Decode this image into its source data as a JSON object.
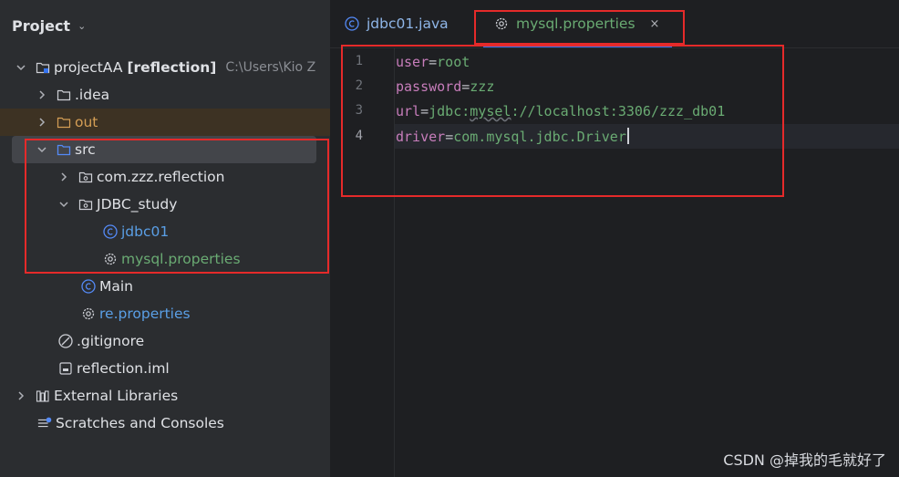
{
  "panel": {
    "title": "Project"
  },
  "tree": [
    {
      "label": "projectAA",
      "suffix": "[reflection]",
      "path": "C:\\Users\\Kio Z",
      "icon": "module-folder-icon",
      "arrow": "expanded"
    },
    {
      "label": ".idea",
      "icon": "folder-icon",
      "arrow": "collapsed"
    },
    {
      "label": "out",
      "icon": "folder-excluded-icon",
      "arrow": "collapsed"
    },
    {
      "label": "src",
      "icon": "source-folder-icon",
      "arrow": "expanded"
    },
    {
      "label": "com.zzz.reflection",
      "icon": "package-icon",
      "arrow": "collapsed"
    },
    {
      "label": "JDBC_study",
      "icon": "package-icon",
      "arrow": "expanded"
    },
    {
      "label": "jdbc01",
      "icon": "class-icon"
    },
    {
      "label": "mysql.properties",
      "icon": "properties-gear-icon"
    },
    {
      "label": "Main",
      "icon": "class-icon"
    },
    {
      "label": "re.properties",
      "icon": "properties-gear-icon"
    },
    {
      "label": ".gitignore",
      "icon": "ignored-file-icon"
    },
    {
      "label": "reflection.iml",
      "icon": "iml-file-icon"
    },
    {
      "label": "External Libraries",
      "icon": "libraries-icon",
      "arrow": "collapsed"
    },
    {
      "label": "Scratches and Consoles",
      "icon": "scratches-icon"
    }
  ],
  "tabs": [
    {
      "label": "jdbc01.java",
      "icon": "class-icon"
    },
    {
      "label": "mysql.properties",
      "icon": "gear-icon",
      "close": "×"
    }
  ],
  "editor": {
    "line_numbers": [
      "1",
      "2",
      "3",
      "4"
    ],
    "lines": [
      {
        "key": "user",
        "eq": "=",
        "value": "root"
      },
      {
        "key": "password",
        "eq": "=",
        "value": "zzz"
      },
      {
        "key": "url",
        "eq": "=",
        "value_a": "jdbc:",
        "value_b": "mysel",
        "value_c": "://localhost:3306/zzz_db01"
      },
      {
        "key": "driver",
        "eq": "=",
        "value": "com.mysql.jdbc.Driver"
      }
    ]
  },
  "watermark": "CSDN @掉我的毛就好了",
  "colors": {
    "annotation_red": "#e52a2a",
    "accent_blue": "#3574f0",
    "string_green": "#6aab73"
  }
}
